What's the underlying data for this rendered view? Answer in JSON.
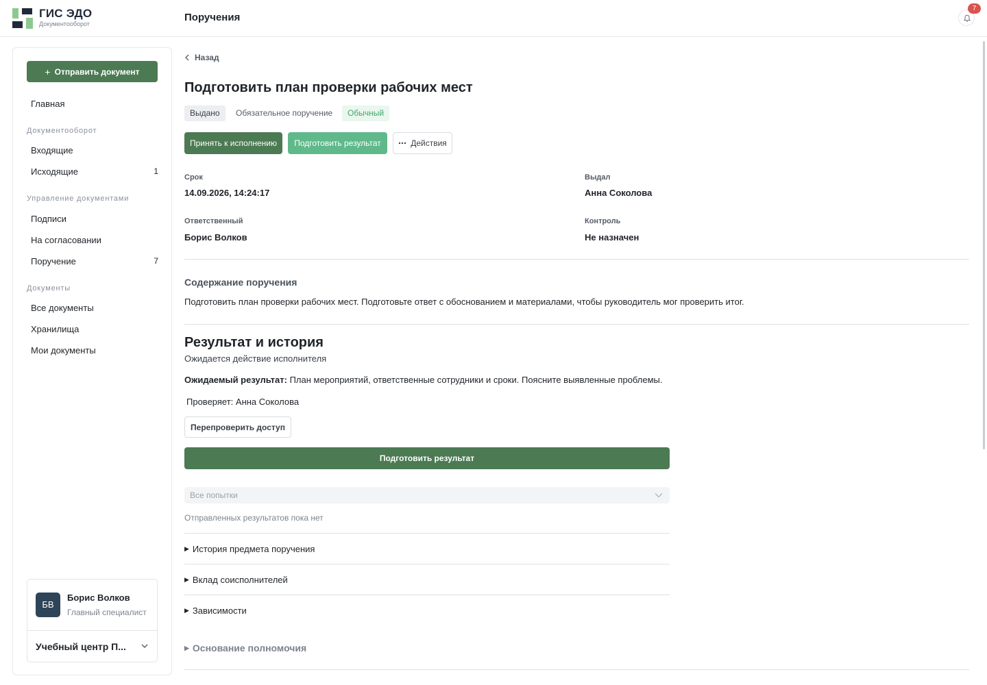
{
  "app": {
    "brand_title": "ГИС ЭДО",
    "brand_subtitle": "Документооборот",
    "page_header": "Поручения",
    "notification_count": "7"
  },
  "sidebar": {
    "send_button": "Отправить документ",
    "home": "Главная",
    "groups": [
      {
        "title": "Документооборот",
        "items": [
          {
            "label": "Входящие",
            "count": ""
          },
          {
            "label": "Исходящие",
            "count": "1"
          }
        ]
      },
      {
        "title": "Управление документами",
        "items": [
          {
            "label": "Подписи",
            "count": ""
          },
          {
            "label": "На согласовании",
            "count": ""
          },
          {
            "label": "Поручение",
            "count": "7"
          }
        ]
      },
      {
        "title": "Документы",
        "items": [
          {
            "label": "Все документы",
            "count": ""
          },
          {
            "label": "Хранилища",
            "count": ""
          },
          {
            "label": "Мои документы",
            "count": ""
          }
        ]
      }
    ],
    "user": {
      "initials": "БВ",
      "name": "Борис Волков",
      "role": "Главный специалист",
      "organization": "Учебный центр П..."
    }
  },
  "task": {
    "back": "Назад",
    "title": "Подготовить план проверки рабочих мест",
    "tags": {
      "status": "Выдано",
      "type": "Обязательное поручение",
      "priority": "Обычный"
    },
    "actions": {
      "accept": "Принять к исполнению",
      "prepare": "Подготовить результат",
      "more": "Действия"
    },
    "fields": {
      "deadline_label": "Срок",
      "deadline_value": "14.09.2026, 14:24:17",
      "issuer_label": "Выдал",
      "issuer_value": "Анна Соколова",
      "responsible_label": "Ответственный",
      "responsible_value": "Борис Волков",
      "control_label": "Контроль",
      "control_value": "Не назначен"
    },
    "content_title": "Содержание поручения",
    "content_text": "Подготовить план проверки рабочих мест. Подготовьте ответ с обоснованием и материалами, чтобы руководитель мог проверить итог."
  },
  "result": {
    "title": "Результат и история",
    "status": "Ожидается действие исполнителя",
    "expected_label": "Ожидаемый результат:",
    "expected_text": "План мероприятий, ответственные сотрудники и сроки. Поясните выявленные проблемы.",
    "checker": "Проверяет: Анна Соколова",
    "recheck_button": "Перепроверить доступ",
    "prepare_button": "Подготовить результат",
    "attempts_placeholder": "Все попытки",
    "no_results": "Отправленных результатов пока нет",
    "sections": [
      "История предмета поручения",
      "Вклад соисполнителей",
      "Зависимости"
    ],
    "basis": "Основание полномочия"
  },
  "colors": {
    "primary_green": "#4b7a53",
    "light_green": "#5fb98a",
    "navy": "#1f2a3a",
    "badge_red": "#d9534f"
  },
  "icons": [
    "logo-icon",
    "bell-icon",
    "plus-icon",
    "chevron-left-icon",
    "more-dots-icon",
    "chevron-down-icon",
    "triangle-right-icon"
  ]
}
